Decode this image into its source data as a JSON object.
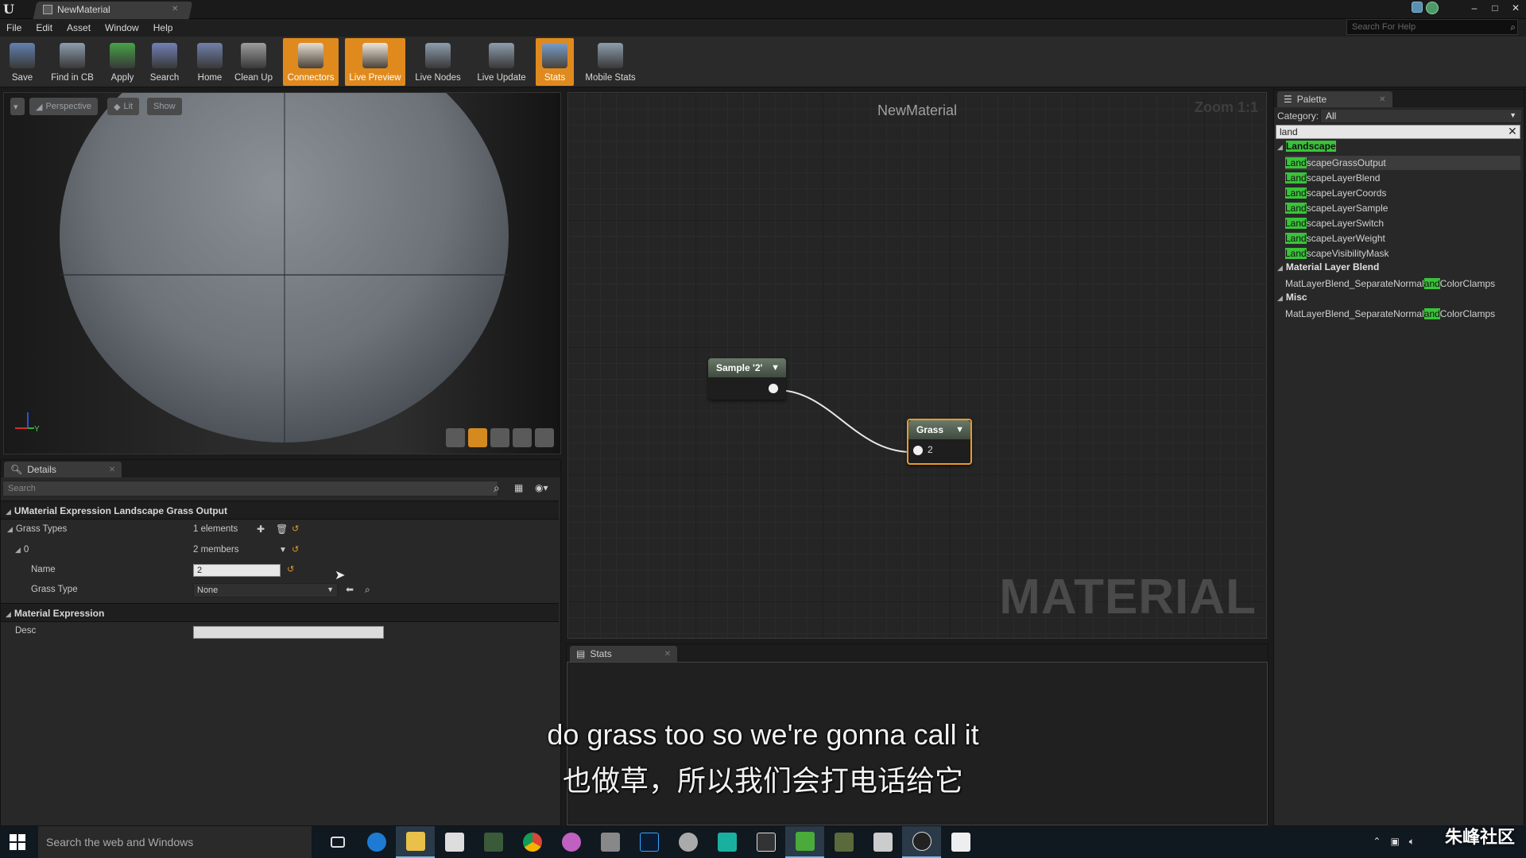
{
  "window": {
    "doc_tab": "NewMaterial",
    "controls": [
      "–",
      "□",
      "✕"
    ]
  },
  "menu": [
    "File",
    "Edit",
    "Asset",
    "Window",
    "Help"
  ],
  "help_search_placeholder": "Search For Help",
  "toolbar": {
    "buttons": [
      {
        "label": "Save",
        "icon": "save-icon",
        "active": false
      },
      {
        "label": "Find in CB",
        "icon": "magnifier-icon",
        "active": false
      },
      {
        "label": "Apply",
        "icon": "checkmark-icon",
        "active": false
      },
      {
        "label": "Search",
        "icon": "binoculars-icon",
        "active": false
      },
      {
        "label": "Home",
        "icon": "home-icon",
        "active": false
      },
      {
        "label": "Clean Up",
        "icon": "broom-icon",
        "active": false
      },
      {
        "label": "Connectors",
        "icon": "connectors-icon",
        "active": true
      },
      {
        "label": "Live Preview",
        "icon": "live-preview-icon",
        "active": true
      },
      {
        "label": "Live Nodes",
        "icon": "live-nodes-icon",
        "active": false
      },
      {
        "label": "Live Update",
        "icon": "live-update-icon",
        "active": false
      },
      {
        "label": "Stats",
        "icon": "stats-icon",
        "active": true
      },
      {
        "label": "Mobile Stats",
        "icon": "mobile-stats-icon",
        "active": false
      }
    ]
  },
  "viewport": {
    "perspective": "Perspective",
    "lit": "Lit",
    "show": "Show",
    "axis_label": "Y"
  },
  "details": {
    "tab": "Details",
    "search_placeholder": "Search",
    "sections": {
      "main": "UMaterial Expression Landscape Grass Output",
      "grass_types": "Grass Types",
      "grass_types_value": "1 elements",
      "index": "0",
      "index_value": "2 members",
      "name_label": "Name",
      "name_value": "2",
      "grass_type_label": "Grass Type",
      "grass_type_value": "None",
      "material_expression": "Material Expression",
      "desc": "Desc"
    }
  },
  "graph": {
    "title": "NewMaterial",
    "zoom": "Zoom 1:1",
    "watermark": "MATERIAL",
    "node1": {
      "title": "Sample '2'"
    },
    "node2": {
      "title": "Grass",
      "pin": "2"
    }
  },
  "stats": {
    "tab": "Stats"
  },
  "palette": {
    "tab": "Palette",
    "category_label": "Category:",
    "category_value": "All",
    "search": "land",
    "groups": [
      {
        "name": "Landscape",
        "items": [
          {
            "hl": "Land",
            "rest": "scapeGrassOutput"
          },
          {
            "hl": "Land",
            "rest": "scapeLayerBlend"
          },
          {
            "hl": "Land",
            "rest": "scapeLayerCoords"
          },
          {
            "hl": "Land",
            "rest": "scapeLayerSample"
          },
          {
            "hl": "Land",
            "rest": "scapeLayerSwitch"
          },
          {
            "hl": "Land",
            "rest": "scapeLayerWeight"
          },
          {
            "hl": "Land",
            "rest": "scapeVisibilityMask"
          }
        ]
      },
      {
        "name": "Material Layer Blend",
        "items": [
          {
            "pre": "MatLayerBlend_SeparateNormal",
            "hl": "and",
            "rest": "ColorClamps"
          }
        ]
      },
      {
        "name": "Misc",
        "items": [
          {
            "pre": "MatLayerBlend_SeparateNormal",
            "hl": "and",
            "rest": "ColorClamps"
          }
        ]
      }
    ]
  },
  "subtitles": {
    "en": "do grass too so we're gonna call it",
    "zh": "也做草，所以我们会打电话给它"
  },
  "taskbar": {
    "search_placeholder": "Search the web and Windows",
    "site_watermark": "朱峰社区"
  },
  "colors": {
    "accent_orange": "#e08a1e",
    "highlight_green": "#39c339",
    "node_select": "#e89a2a"
  }
}
